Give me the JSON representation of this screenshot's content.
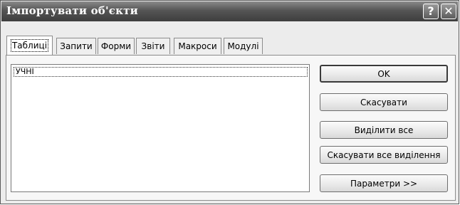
{
  "window": {
    "title": "Імпортувати об'єкти",
    "help_glyph": "?",
    "close_glyph": "✕"
  },
  "tabs": [
    {
      "label": "Таблиці",
      "active": true
    },
    {
      "label": "Запити",
      "active": false
    },
    {
      "label": "Форми",
      "active": false
    },
    {
      "label": "Звіти",
      "active": false
    },
    {
      "label": "Макроси",
      "active": false
    },
    {
      "label": "Модулі",
      "active": false
    }
  ],
  "list": {
    "items": [
      "УЧНІ"
    ]
  },
  "buttons": {
    "ok": "OK",
    "cancel": "Скасувати",
    "select_all": "Виділити все",
    "deselect_all": "Скасувати все виділення",
    "options": "Параметри >>"
  },
  "icons": {
    "help": "help-icon",
    "close": "close-icon"
  }
}
